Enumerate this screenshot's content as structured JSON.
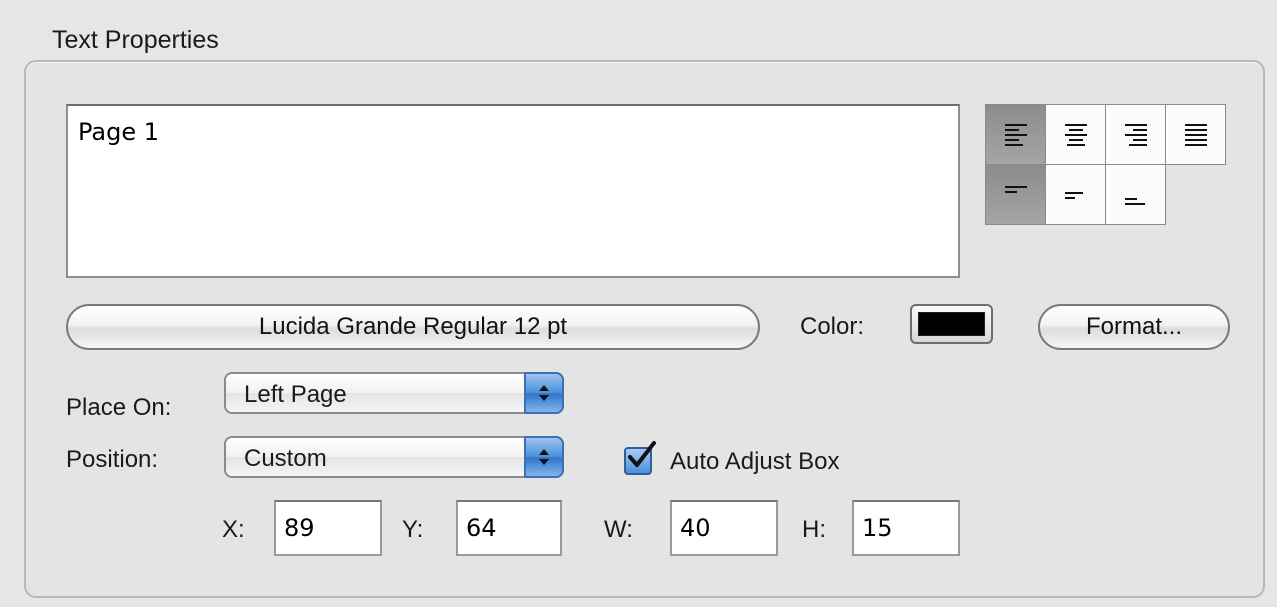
{
  "group": {
    "title": "Text Properties"
  },
  "text_area": {
    "value": "Page 1"
  },
  "alignment": {
    "horizontal": [
      "align-left",
      "align-center",
      "align-right",
      "align-justify"
    ],
    "vertical": [
      "align-top",
      "align-middle",
      "align-bottom"
    ],
    "selected_horizontal": "align-left",
    "selected_vertical": "align-top"
  },
  "font_button": {
    "label": "Lucida Grande Regular 12 pt"
  },
  "color": {
    "label": "Color:",
    "value": "#000000"
  },
  "format_button": {
    "label": "Format..."
  },
  "place_on": {
    "label": "Place On:",
    "value": "Left Page"
  },
  "position": {
    "label": "Position:",
    "value": "Custom"
  },
  "auto_adjust": {
    "label": "Auto Adjust Box",
    "checked": true
  },
  "coords": {
    "x": {
      "label": "X:",
      "value": "89"
    },
    "y": {
      "label": "Y:",
      "value": "64"
    },
    "w": {
      "label": "W:",
      "value": "40"
    },
    "h": {
      "label": "H:",
      "value": "15"
    }
  }
}
